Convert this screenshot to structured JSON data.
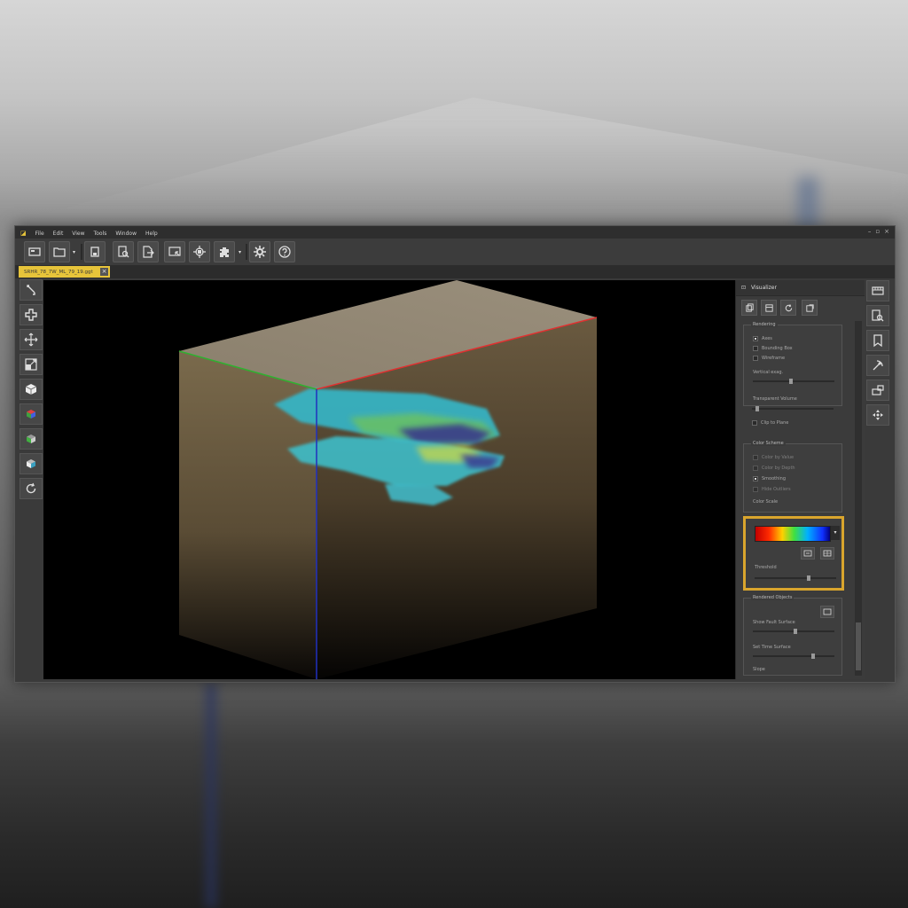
{
  "window": {
    "menus": [
      "File",
      "Edit",
      "View",
      "Tools",
      "Window",
      "Help"
    ],
    "controls": [
      "–",
      "▫",
      "×"
    ]
  },
  "toolbar": {
    "buttons": [
      "new-icon",
      "open-icon",
      "save-icon",
      "search-icon",
      "export-icon",
      "screen-select-icon",
      "target-icon",
      "puzzle-icon",
      "settings-icon",
      "help-icon"
    ]
  },
  "tabs": [
    {
      "label": "SRHR_78_7W_ML_79_19.ggt",
      "active": true
    }
  ],
  "left_tools": [
    "pointer-icon",
    "move-icon",
    "pan-icon",
    "resize-icon",
    "cube-view-icon",
    "cube-color-icon",
    "cube-side-icon",
    "cube-front-icon",
    "reset-rotation-icon"
  ],
  "right_tools": [
    "layout-icon",
    "zoom-icon",
    "bookmark-icon",
    "measure-icon",
    "screenshot-icon",
    "navigate-icon"
  ],
  "panel": {
    "title": "Visualizer",
    "group1": {
      "title": "Rendering",
      "options": [
        {
          "label": "Axes",
          "checked": true
        },
        {
          "label": "Bounding Box",
          "checked": false
        },
        {
          "label": "Wireframe",
          "checked": false
        }
      ],
      "slider1_label": "Vertical exag.",
      "slider1_value": 0.45,
      "slider2_label": "Transparent Volume",
      "slider2_value": 0.05,
      "option_extra": {
        "label": "Clip to Plane",
        "checked": false
      }
    },
    "group2": {
      "title": "Color Scheme",
      "options": [
        {
          "label": "Color by Value",
          "checked": false
        },
        {
          "label": "Color by Depth",
          "checked": false
        },
        {
          "label": "Smoothing",
          "checked": true
        },
        {
          "label": "Hide Outliers",
          "checked": false
        }
      ],
      "scale_label": "Color Scale"
    },
    "colormap": {
      "label": "Colormap",
      "threshold_label": "Threshold",
      "threshold_value": 0.65
    },
    "group3": {
      "title": "Rendered Objects",
      "slider1_label": "Show Fault Surface",
      "slider1_value": 0.5,
      "slider2_label": "Set Time Surface",
      "slider2_value": 0.72,
      "footer": "Slope"
    }
  }
}
